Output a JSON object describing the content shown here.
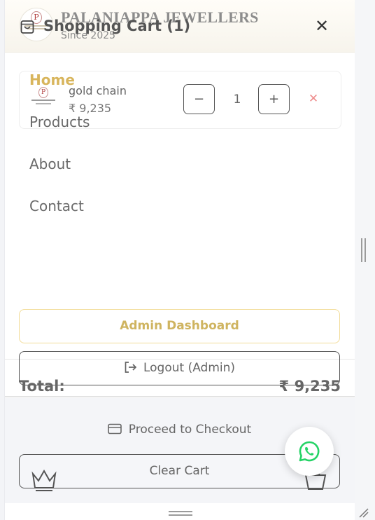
{
  "header": {
    "brand_name": "PALANIAPPA JEWELLERS",
    "since": "Since 2025"
  },
  "cart": {
    "title": "Shopping Cart (1)",
    "items": [
      {
        "name": "gold chain",
        "price": "₹ 9,235",
        "quantity": "1"
      }
    ],
    "total_label": "Total:",
    "total_value": "₹ 9,235",
    "checkout_label": "Proceed to Checkout",
    "clear_label": "Clear Cart"
  },
  "nav": {
    "items": [
      {
        "label": "Home",
        "active": true
      },
      {
        "label": "Products"
      },
      {
        "label": "About"
      },
      {
        "label": "Contact"
      }
    ],
    "admin_label": "Admin Dashboard",
    "logout_label": "Logout (Admin)"
  },
  "colors": {
    "accent_gold": "#d8b55c",
    "remove_red": "#ee8d8d",
    "whatsapp_green": "#25d366"
  },
  "icons": [
    "shopping-bag-icon",
    "close-icon",
    "logout-icon",
    "credit-card-icon",
    "whatsapp-icon",
    "crown-icon",
    "basket-icon",
    "remove-icon"
  ]
}
